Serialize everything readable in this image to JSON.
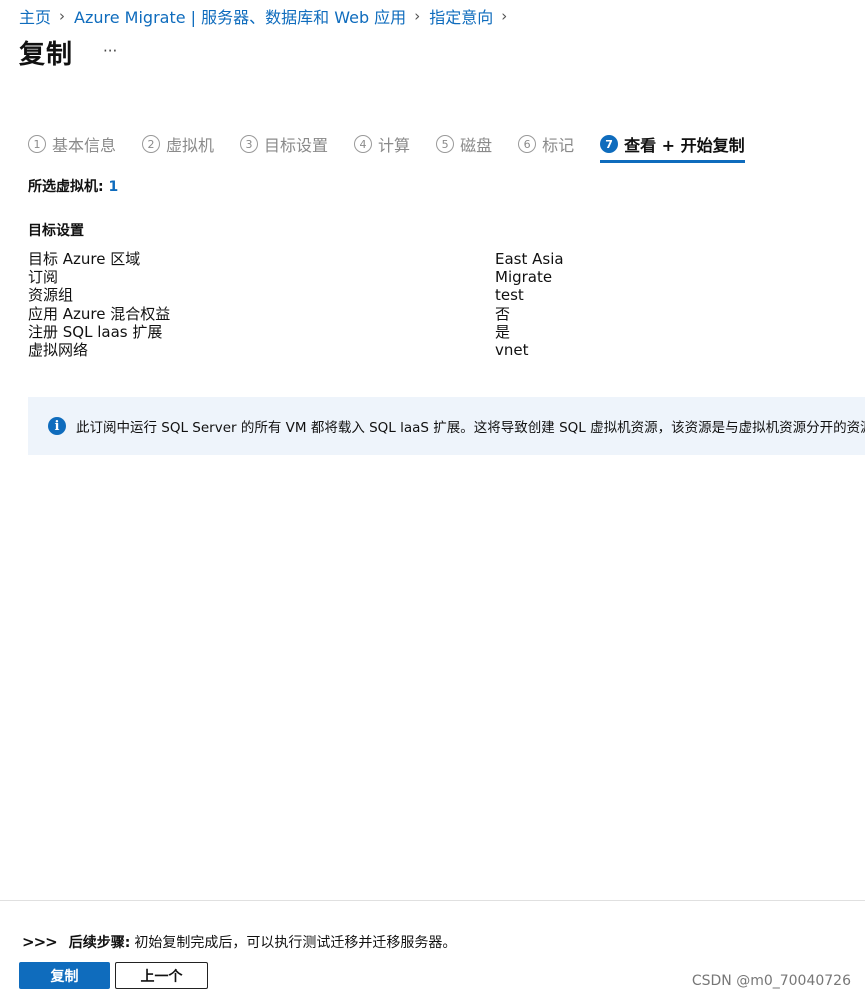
{
  "breadcrumb": {
    "items": [
      "主页",
      "Azure Migrate | 服务器、数据库和 Web 应用",
      "指定意向"
    ]
  },
  "page": {
    "title": "复制",
    "more": "···"
  },
  "tabs": [
    {
      "num": "1",
      "label": "基本信息"
    },
    {
      "num": "2",
      "label": "虚拟机"
    },
    {
      "num": "3",
      "label": "目标设置"
    },
    {
      "num": "4",
      "label": "计算"
    },
    {
      "num": "5",
      "label": "磁盘"
    },
    {
      "num": "6",
      "label": "标记"
    },
    {
      "num": "7",
      "label": "查看 + 开始复制",
      "active": true
    }
  ],
  "selected_vms": {
    "label": "所选虚拟机:",
    "count": "1"
  },
  "target_settings": {
    "heading": "目标设置",
    "rows": [
      {
        "label": "目标 Azure 区域",
        "value": "East Asia"
      },
      {
        "label": "订阅",
        "value": "Migrate"
      },
      {
        "label": "资源组",
        "value": "test"
      },
      {
        "label": "应用 Azure 混合权益",
        "value": "否"
      },
      {
        "label": "注册 SQL laas 扩展",
        "value": "是"
      },
      {
        "label": "虚拟网络",
        "value": "vnet"
      }
    ]
  },
  "info_banner": {
    "icon": "info-icon",
    "text": "此订阅中运行 SQL Server 的所有 VM 都将载入 SQL laaS 扩展。这将导致创建 SQL 虚拟机资源，该资源是与虚拟机资源分开的资源"
  },
  "footer": {
    "chevrons": ">>>",
    "next_steps_label": "后续步骤:",
    "next_steps_text": "初始复制完成后，可以执行测试迁移并迁移服务器。",
    "primary_button": "复制",
    "secondary_button": "上一个"
  },
  "watermark": "CSDN @m0_70040726",
  "colors": {
    "accent": "#0f6cbd",
    "banner_bg": "#eef4fb"
  }
}
